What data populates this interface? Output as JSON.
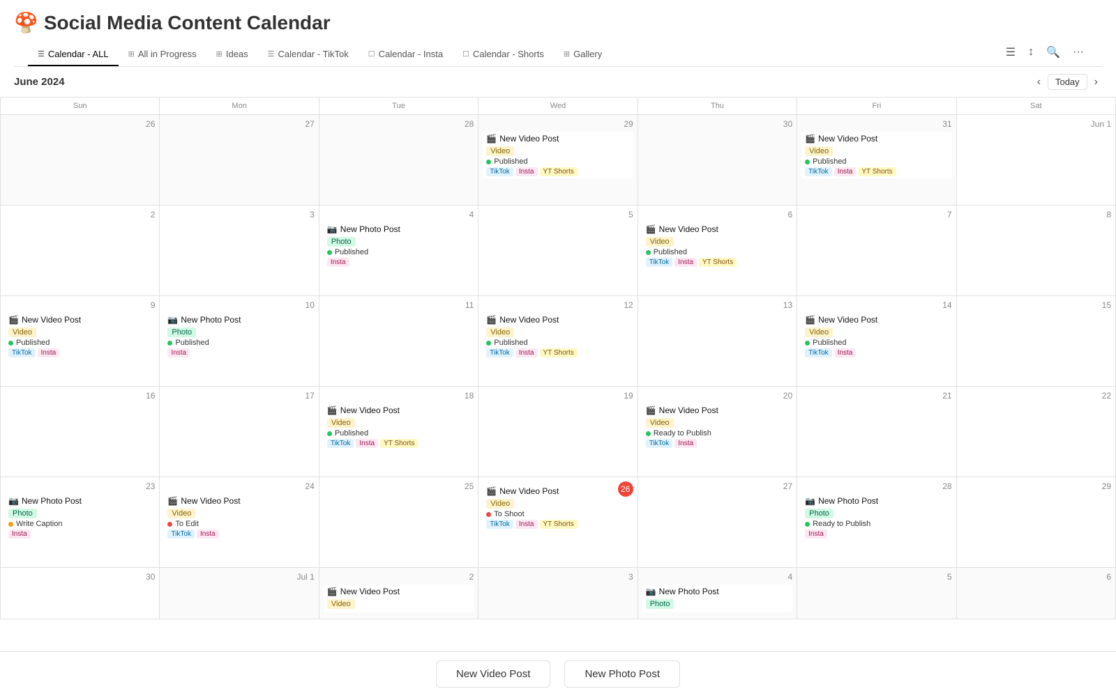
{
  "app": {
    "emoji": "🍄",
    "title": "Social Media Content Calendar"
  },
  "nav": {
    "tabs": [
      {
        "id": "calendar-all",
        "icon": "☰",
        "label": "Calendar - ALL",
        "active": true
      },
      {
        "id": "all-in-progress",
        "icon": "⊞",
        "label": "All in Progress",
        "active": false
      },
      {
        "id": "ideas",
        "icon": "⊞",
        "label": "Ideas",
        "active": false
      },
      {
        "id": "calendar-tiktok",
        "icon": "☰",
        "label": "Calendar - TikTok",
        "active": false
      },
      {
        "id": "calendar-insta",
        "icon": "☐",
        "label": "Calendar - Insta",
        "active": false
      },
      {
        "id": "calendar-shorts",
        "icon": "☐",
        "label": "Calendar - Shorts",
        "active": false
      },
      {
        "id": "gallery",
        "icon": "⊞",
        "label": "Gallery",
        "active": false
      }
    ]
  },
  "calendar": {
    "month_label": "June 2024",
    "today_label": "Today",
    "day_headers": [
      "Sun",
      "Mon",
      "Tue",
      "Wed",
      "Thu",
      "Fri",
      "Sat"
    ]
  },
  "bottom_buttons": {
    "video_label": "New Video Post",
    "photo_label": "New Photo Post"
  },
  "weeks": [
    {
      "days": [
        {
          "num": "26",
          "other": true,
          "events": []
        },
        {
          "num": "27",
          "other": true,
          "events": []
        },
        {
          "num": "28",
          "other": true,
          "events": []
        },
        {
          "num": "29",
          "other": true,
          "events": [
            {
              "emoji": "🎬",
              "title": "New Video Post",
              "tag": "Video",
              "tag_class": "tag-video",
              "status": "Published",
              "status_dot": "dot-published",
              "platforms": [
                {
                  "label": "TikTok",
                  "cls": "ptag-tiktok"
                },
                {
                  "label": "Insta",
                  "cls": "ptag-insta"
                },
                {
                  "label": "YT Shorts",
                  "cls": "ptag-yt"
                }
              ]
            }
          ]
        },
        {
          "num": "30",
          "other": true,
          "events": []
        },
        {
          "num": "31",
          "other": true,
          "events": [
            {
              "emoji": "🎬",
              "title": "New Video Post",
              "tag": "Video",
              "tag_class": "tag-video",
              "status": "Published",
              "status_dot": "dot-published",
              "platforms": [
                {
                  "label": "TikTok",
                  "cls": "ptag-tiktok"
                },
                {
                  "label": "Insta",
                  "cls": "ptag-insta"
                },
                {
                  "label": "YT Shorts",
                  "cls": "ptag-yt"
                }
              ]
            }
          ]
        },
        {
          "num": "Jun 1",
          "other": false,
          "events": []
        }
      ]
    },
    {
      "days": [
        {
          "num": "2",
          "other": false,
          "events": []
        },
        {
          "num": "3",
          "other": false,
          "events": []
        },
        {
          "num": "4",
          "other": false,
          "events": [
            {
              "emoji": "📷",
              "title": "New Photo Post",
              "tag": "Photo",
              "tag_class": "tag-photo",
              "status": "Published",
              "status_dot": "dot-published",
              "platforms": [
                {
                  "label": "Insta",
                  "cls": "ptag-insta"
                }
              ]
            }
          ]
        },
        {
          "num": "5",
          "other": false,
          "events": []
        },
        {
          "num": "6",
          "other": false,
          "events": [
            {
              "emoji": "🎬",
              "title": "New Video Post",
              "tag": "Video",
              "tag_class": "tag-video",
              "status": "Published",
              "status_dot": "dot-published",
              "platforms": [
                {
                  "label": "TikTok",
                  "cls": "ptag-tiktok"
                },
                {
                  "label": "Insta",
                  "cls": "ptag-insta"
                },
                {
                  "label": "YT Shorts",
                  "cls": "ptag-yt"
                }
              ]
            }
          ]
        },
        {
          "num": "7",
          "other": false,
          "events": []
        },
        {
          "num": "8",
          "other": false,
          "events": []
        }
      ]
    },
    {
      "days": [
        {
          "num": "9",
          "other": false,
          "events": [
            {
              "emoji": "🎬",
              "title": "New Video Post",
              "tag": "Video",
              "tag_class": "tag-video",
              "status": "Published",
              "status_dot": "dot-published",
              "platforms": [
                {
                  "label": "TikTok",
                  "cls": "ptag-tiktok"
                },
                {
                  "label": "Insta",
                  "cls": "ptag-insta"
                }
              ]
            }
          ]
        },
        {
          "num": "10",
          "other": false,
          "events": [
            {
              "emoji": "📷",
              "title": "New Photo Post",
              "tag": "Photo",
              "tag_class": "tag-photo",
              "status": "Published",
              "status_dot": "dot-published",
              "platforms": [
                {
                  "label": "Insta",
                  "cls": "ptag-insta"
                }
              ]
            }
          ]
        },
        {
          "num": "11",
          "other": false,
          "events": []
        },
        {
          "num": "12",
          "other": false,
          "events": [
            {
              "emoji": "🎬",
              "title": "New Video Post",
              "tag": "Video",
              "tag_class": "tag-video",
              "status": "Published",
              "status_dot": "dot-published",
              "platforms": [
                {
                  "label": "TikTok",
                  "cls": "ptag-tiktok"
                },
                {
                  "label": "Insta",
                  "cls": "ptag-insta"
                },
                {
                  "label": "YT Shorts",
                  "cls": "ptag-yt"
                }
              ]
            }
          ]
        },
        {
          "num": "13",
          "other": false,
          "events": []
        },
        {
          "num": "14",
          "other": false,
          "events": [
            {
              "emoji": "🎬",
              "title": "New Video Post",
              "tag": "Video",
              "tag_class": "tag-video",
              "status": "Published",
              "status_dot": "dot-published",
              "platforms": [
                {
                  "label": "TikTok",
                  "cls": "ptag-tiktok"
                },
                {
                  "label": "Insta",
                  "cls": "ptag-insta"
                }
              ]
            }
          ]
        },
        {
          "num": "15",
          "other": false,
          "events": []
        }
      ]
    },
    {
      "days": [
        {
          "num": "16",
          "other": false,
          "events": []
        },
        {
          "num": "17",
          "other": false,
          "events": []
        },
        {
          "num": "18",
          "other": false,
          "events": [
            {
              "emoji": "🎬",
              "title": "New Video Post",
              "tag": "Video",
              "tag_class": "tag-video",
              "status": "Published",
              "status_dot": "dot-published",
              "platforms": [
                {
                  "label": "TikTok",
                  "cls": "ptag-tiktok"
                },
                {
                  "label": "Insta",
                  "cls": "ptag-insta"
                },
                {
                  "label": "YT Shorts",
                  "cls": "ptag-yt"
                }
              ]
            }
          ]
        },
        {
          "num": "19",
          "other": false,
          "events": []
        },
        {
          "num": "20",
          "other": false,
          "events": [
            {
              "emoji": "🎬",
              "title": "New Video Post",
              "tag": "Video",
              "tag_class": "tag-video",
              "status": "Ready to Publish",
              "status_dot": "dot-ready",
              "platforms": [
                {
                  "label": "TikTok",
                  "cls": "ptag-tiktok"
                },
                {
                  "label": "Insta",
                  "cls": "ptag-insta"
                }
              ]
            }
          ]
        },
        {
          "num": "21",
          "other": false,
          "events": []
        },
        {
          "num": "22",
          "other": false,
          "events": []
        }
      ]
    },
    {
      "days": [
        {
          "num": "23",
          "other": false,
          "events": [
            {
              "emoji": "📷",
              "title": "New Photo Post",
              "tag": "Photo",
              "tag_class": "tag-photo",
              "status": "Write Caption",
              "status_dot": "dot-write",
              "platforms": [
                {
                  "label": "Insta",
                  "cls": "ptag-insta"
                }
              ]
            }
          ]
        },
        {
          "num": "24",
          "other": false,
          "events": [
            {
              "emoji": "🎬",
              "title": "New Video Post",
              "tag": "Video",
              "tag_class": "tag-video",
              "status": "To Edit",
              "status_dot": "dot-edit",
              "platforms": [
                {
                  "label": "TikTok",
                  "cls": "ptag-tiktok"
                },
                {
                  "label": "Insta",
                  "cls": "ptag-insta"
                }
              ]
            }
          ]
        },
        {
          "num": "25",
          "other": false,
          "events": []
        },
        {
          "num": "26",
          "other": false,
          "today": true,
          "events": [
            {
              "emoji": "🎬",
              "title": "New Video Post",
              "tag": "Video",
              "tag_class": "tag-video",
              "status": "To Shoot",
              "status_dot": "dot-shoot",
              "platforms": [
                {
                  "label": "TikTok",
                  "cls": "ptag-tiktok"
                },
                {
                  "label": "Insta",
                  "cls": "ptag-insta"
                },
                {
                  "label": "YT Shorts",
                  "cls": "ptag-yt"
                }
              ]
            }
          ]
        },
        {
          "num": "27",
          "other": false,
          "events": []
        },
        {
          "num": "28",
          "other": false,
          "events": [
            {
              "emoji": "📷",
              "title": "New Photo Post",
              "tag": "Photo",
              "tag_class": "tag-photo",
              "status": "Ready to Publish",
              "status_dot": "dot-ready",
              "platforms": [
                {
                  "label": "Insta",
                  "cls": "ptag-insta"
                }
              ]
            }
          ]
        },
        {
          "num": "29",
          "other": false,
          "events": []
        }
      ]
    },
    {
      "days": [
        {
          "num": "30",
          "other": false,
          "events": []
        },
        {
          "num": "Jul 1",
          "other": true,
          "events": []
        },
        {
          "num": "2",
          "other": true,
          "events": [
            {
              "emoji": "🎬",
              "title": "New Video Post",
              "tag": "Video",
              "tag_class": "tag-video",
              "status": "",
              "status_dot": "",
              "platforms": []
            }
          ]
        },
        {
          "num": "3",
          "other": true,
          "events": []
        },
        {
          "num": "4",
          "other": true,
          "events": [
            {
              "emoji": "📷",
              "title": "New Photo Post",
              "tag": "Photo",
              "tag_class": "tag-photo",
              "status": "",
              "status_dot": "",
              "platforms": []
            }
          ]
        },
        {
          "num": "5",
          "other": true,
          "events": []
        },
        {
          "num": "6",
          "other": true,
          "events": []
        }
      ]
    }
  ]
}
